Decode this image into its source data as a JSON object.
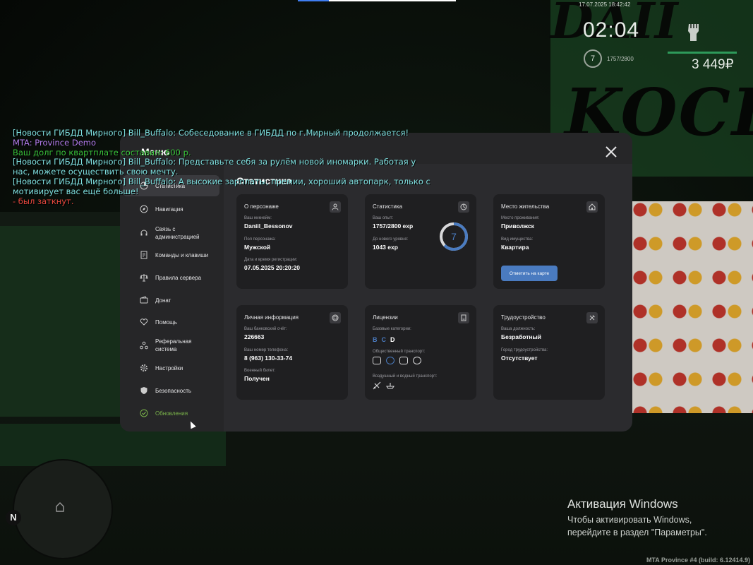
{
  "hud": {
    "date": "17.07.2025 18:42:42",
    "time": "02:04",
    "level": "7",
    "exp": "1757/2800",
    "money": "3 449₽"
  },
  "chat": [
    {
      "text": "[Новости ГИБДД Мирного] Bill_Buffalo: Собеседование в ГИБДД по г.Мирный продолжается!",
      "color": "#7fe0e0"
    },
    {
      "text": "MTA: Province Demo",
      "color": "#b57ef0"
    },
    {
      "text": "Ваш долг по квартплате составил: 600 р.",
      "color": "#39c23b"
    },
    {
      "text": "[Новости ГИБДД Мирного] Bill_Buffalo: Представьте себя за рулём новой иномарки. Работая у",
      "color": "#7fe0e0"
    },
    {
      "text": "нас, можете осуществить свою мечту.",
      "color": "#7fe0e0"
    },
    {
      "text": "[Новости ГИБДД Мирного] Bill_Buffalo: А высокие зарплаты, премии, хороший автопарк, только с",
      "color": "#7fe0e0"
    },
    {
      "text": "мотивирует вас ещё больше!",
      "color": "#7fe0e0"
    },
    {
      "text": "- был заткнут.",
      "color": "#e8473e"
    }
  ],
  "modal": {
    "title": "Меню",
    "content_title": "Статистика",
    "nav": [
      {
        "label": "Статистика",
        "icon": "chart-icon"
      },
      {
        "label": "Навигация",
        "icon": "compass-icon"
      },
      {
        "label": "Связь с администрацией",
        "icon": "headset-icon"
      },
      {
        "label": "Команды и клавиши",
        "icon": "keyboard-icon"
      },
      {
        "label": "Правила сервера",
        "icon": "scales-icon"
      },
      {
        "label": "Донат",
        "icon": "wallet-icon"
      },
      {
        "label": "Помощь",
        "icon": "heart-hands-icon"
      },
      {
        "label": "Реферальная система",
        "icon": "referral-icon"
      },
      {
        "label": "Настройки",
        "icon": "gear-icon"
      },
      {
        "label": "Безопасность",
        "icon": "shield-icon"
      },
      {
        "label": "Обновления",
        "icon": "update-icon"
      }
    ],
    "cards": {
      "character": {
        "title": "О персонаже",
        "nickname_label": "Ваш никнейм:",
        "nickname": "Daniil_Bessonov",
        "gender_label": "Пол персонажа:",
        "gender": "Мужской",
        "reg_label": "Дата и время регистрации:",
        "reg": "07.05.2025 20:20:20"
      },
      "stats": {
        "title": "Статистика",
        "exp_label": "Ваш опыт:",
        "exp": "1757/2800 exp",
        "next_label": "До нового уровня:",
        "next": "1043 exp",
        "level": "7",
        "progress": 0.6275
      },
      "residence": {
        "title": "Место жительства",
        "place_label": "Место проживания:",
        "place": "Приволжск",
        "property_label": "Вид имущества:",
        "property": "Квартира",
        "button": "Отметить на карте"
      },
      "personal": {
        "title": "Личная информация",
        "bank_label": "Ваш банковский счёт:",
        "bank": "226663",
        "phone_label": "Ваш номер телефона:",
        "phone": "8 (963) 130-33-74",
        "military_label": "Военный билет:",
        "military": "Получен"
      },
      "licenses": {
        "title": "Лицензии",
        "base_label": "Базовые категории:",
        "cats": [
          "B",
          "C",
          "D"
        ],
        "public_label": "Общественный транспорт:",
        "air_label": "Воздушный и водный транспорт:"
      },
      "employment": {
        "title": "Трудоустройство",
        "position_label": "Ваша должность:",
        "position": "Безработный",
        "city_label": "Город трудоустройства:",
        "city": "Отсутствует"
      }
    }
  },
  "minimap": {
    "north": "N"
  },
  "windows": {
    "title": "Активация Windows",
    "line1": "Чтобы активировать Windows,",
    "line2": "перейдите в раздел \"Параметры\"."
  },
  "build": "MTA Province #4 (build: 6.12414.9)",
  "colors": {
    "accent_green": "#7ab34a",
    "accent_blue": "#4a7bc0",
    "card_bg": "#1f1f21",
    "modal_bg": "#2b2b2e"
  }
}
